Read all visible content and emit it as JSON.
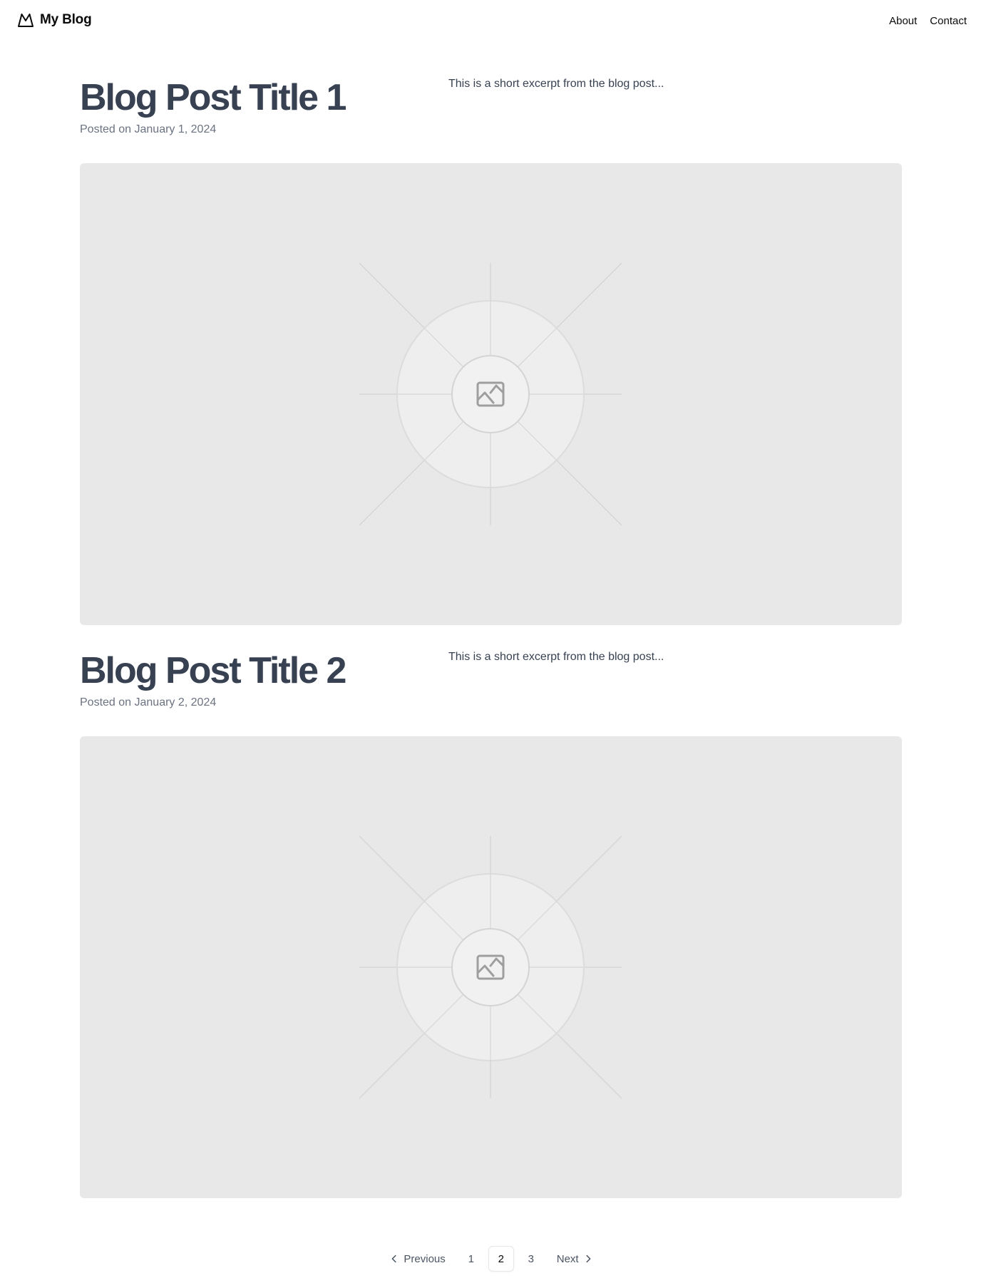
{
  "header": {
    "brand": "My Blog",
    "brand_icon": "mountain-logo-icon",
    "nav": [
      {
        "label": "About"
      },
      {
        "label": "Contact"
      }
    ]
  },
  "posts": [
    {
      "title": "Blog Post Title 1",
      "date": "Posted on January 1, 2024",
      "excerpt": "This is a short excerpt from the blog post...",
      "image_icon": "image-placeholder-icon"
    },
    {
      "title": "Blog Post Title 2",
      "date": "Posted on January 2, 2024",
      "excerpt": "This is a short excerpt from the blog post...",
      "image_icon": "image-placeholder-icon"
    }
  ],
  "pagination": {
    "previous": "Previous",
    "next": "Next",
    "pages": [
      "1",
      "2",
      "3"
    ],
    "current_page": "2"
  },
  "colors": {
    "title": "#374151",
    "muted": "#6b7280",
    "placeholder_bg": "#e8e8e8"
  }
}
